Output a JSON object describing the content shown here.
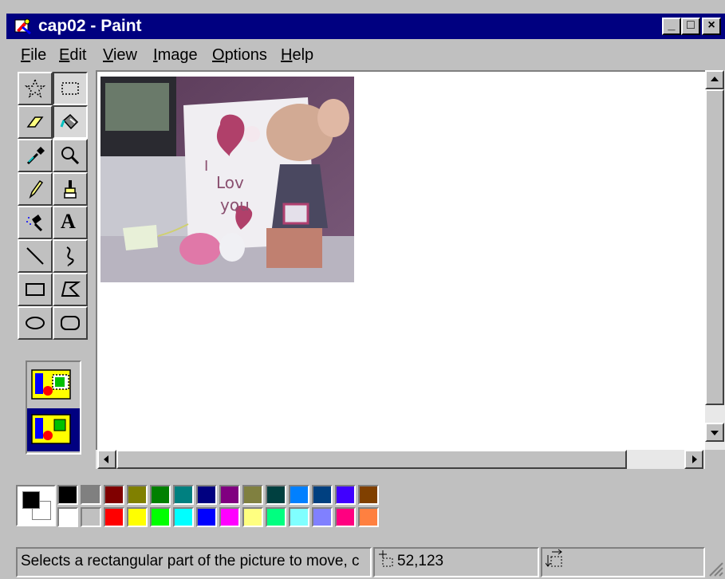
{
  "window": {
    "title": "cap02 - Paint",
    "minimize_label": "_",
    "maximize_label": "□",
    "close_label": "×"
  },
  "menu": {
    "items": [
      {
        "label": "File"
      },
      {
        "label": "Edit"
      },
      {
        "label": "View"
      },
      {
        "label": "Image"
      },
      {
        "label": "Options"
      },
      {
        "label": "Help"
      }
    ]
  },
  "tools": [
    {
      "name": "free-form-select",
      "icon": "star-select-icon"
    },
    {
      "name": "select",
      "icon": "rect-select-icon",
      "selected": true
    },
    {
      "name": "eraser",
      "icon": "eraser-icon"
    },
    {
      "name": "fill-with-color",
      "icon": "paint-bucket-icon"
    },
    {
      "name": "pick-color",
      "icon": "eyedropper-icon"
    },
    {
      "name": "magnifier",
      "icon": "magnifier-icon"
    },
    {
      "name": "pencil",
      "icon": "pencil-icon"
    },
    {
      "name": "brush",
      "icon": "brush-icon"
    },
    {
      "name": "airbrush",
      "icon": "airbrush-icon"
    },
    {
      "name": "text",
      "icon": "text-icon",
      "glyph": "A"
    },
    {
      "name": "line",
      "icon": "line-icon"
    },
    {
      "name": "curve",
      "icon": "curve-icon"
    },
    {
      "name": "rectangle",
      "icon": "rectangle-icon"
    },
    {
      "name": "polygon",
      "icon": "polygon-icon"
    },
    {
      "name": "ellipse",
      "icon": "ellipse-icon"
    },
    {
      "name": "rounded-rectangle",
      "icon": "rounded-rectangle-icon"
    }
  ],
  "options": [
    {
      "name": "opaque-selection",
      "icon": "opaque-selection-icon"
    },
    {
      "name": "transparent-selection",
      "icon": "transparent-selection-icon",
      "selected": true
    }
  ],
  "palette": {
    "foreground": "#000000",
    "background": "#ffffff",
    "row1": [
      "#000000",
      "#808080",
      "#800000",
      "#808000",
      "#008000",
      "#008080",
      "#000080",
      "#800080",
      "#808040",
      "#004040",
      "#0080ff",
      "#004080",
      "#4000ff",
      "#804000"
    ],
    "row2": [
      "#ffffff",
      "#c0c0c0",
      "#ff0000",
      "#ffff00",
      "#00ff00",
      "#00ffff",
      "#0000ff",
      "#ff00ff",
      "#ffff80",
      "#00ff80",
      "#80ffff",
      "#8080ff",
      "#ff0080",
      "#ff8040"
    ]
  },
  "status": {
    "message": "Selects a rectangular part of the picture to move, c",
    "coordinates": "52,123",
    "selection_size": ""
  }
}
